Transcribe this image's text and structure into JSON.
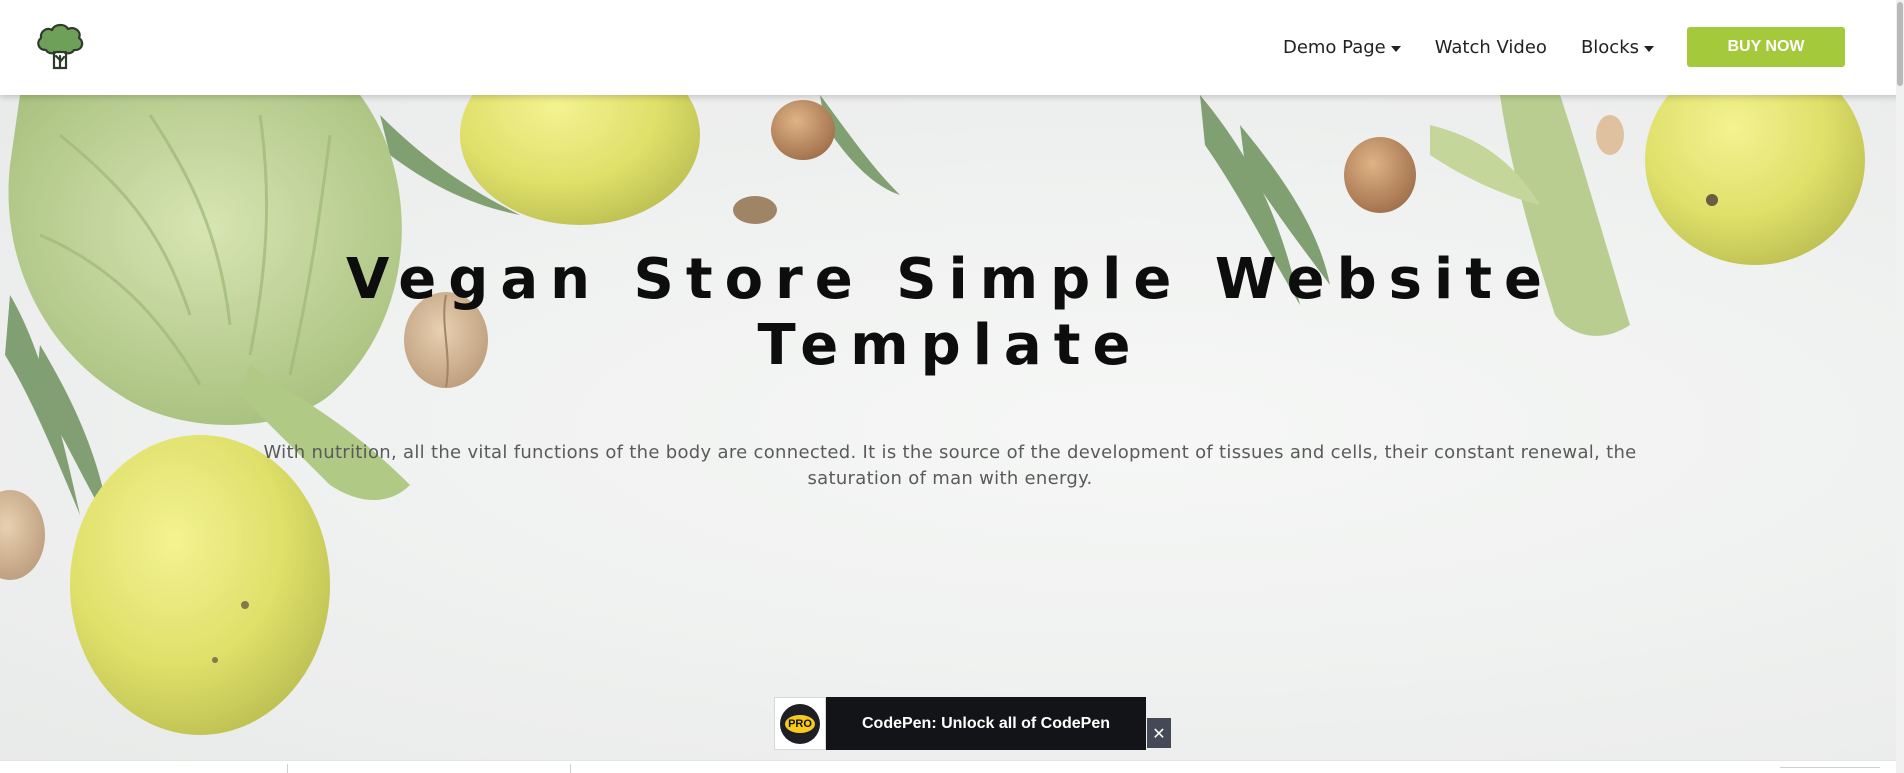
{
  "header": {
    "logo_icon": "broccoli-icon",
    "nav": [
      {
        "label": "Demo Page",
        "has_dropdown": true
      },
      {
        "label": "Watch Video",
        "has_dropdown": false
      },
      {
        "label": "Blocks",
        "has_dropdown": true
      }
    ],
    "cta_label": "BUY NOW",
    "cta_color": "#a4c93a"
  },
  "hero": {
    "title_line1": "Vegan Store Simple Website",
    "title_line2": "Template",
    "subtitle_line1": "With nutrition, all the vital functions of the body are connected. It is the source of the development of tissues and cells, their constant renewal, the",
    "subtitle_line2": "saturation of man with energy."
  },
  "codepen_banner": {
    "badge": "PRO",
    "text": "CodePen: Unlock all of CodePen",
    "close_icon": "close-icon"
  }
}
